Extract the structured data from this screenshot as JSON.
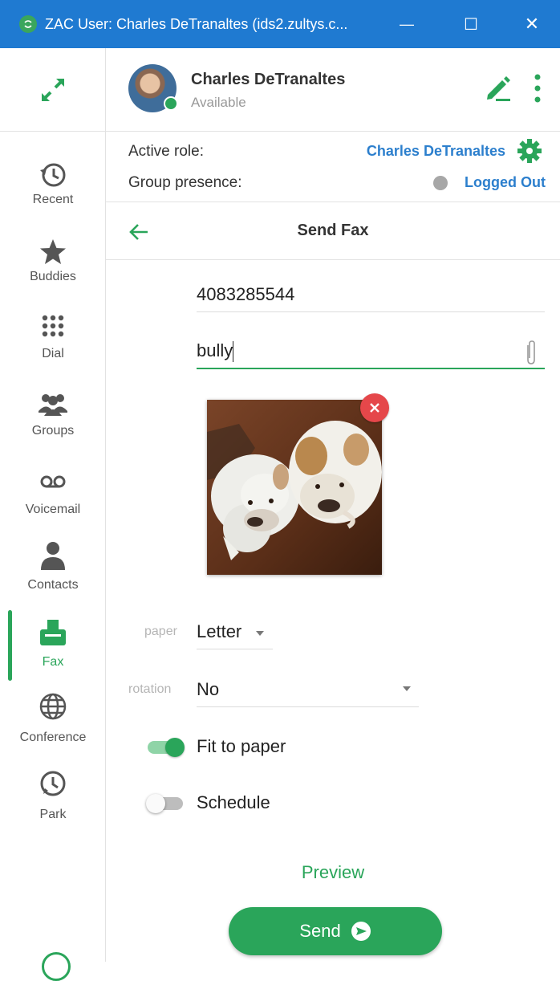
{
  "window": {
    "title": "ZAC User: Charles DeTranaltes (ids2.zultys.c...",
    "minimize_glyph": "—",
    "maximize_glyph": "☐",
    "close_glyph": "✕"
  },
  "sidebar": {
    "items": [
      {
        "label": "Recent",
        "icon": "history-icon"
      },
      {
        "label": "Buddies",
        "icon": "star-icon"
      },
      {
        "label": "Dial",
        "icon": "dialpad-icon"
      },
      {
        "label": "Groups",
        "icon": "group-icon"
      },
      {
        "label": "Voicemail",
        "icon": "voicemail-icon"
      },
      {
        "label": "Contacts",
        "icon": "person-icon"
      },
      {
        "label": "Fax",
        "icon": "fax-icon",
        "active": true
      },
      {
        "label": "Conference",
        "icon": "globe-icon"
      },
      {
        "label": "Park",
        "icon": "park-icon"
      }
    ]
  },
  "user": {
    "name": "Charles DeTranaltes",
    "status": "Available"
  },
  "roles": {
    "active_role_label": "Active role:",
    "active_role_value": "Charles DeTranaltes",
    "group_presence_label": "Group presence:",
    "group_presence_value": "Logged Out"
  },
  "page": {
    "title": "Send Fax"
  },
  "form": {
    "fax_number": "4083285544",
    "subject": "bully",
    "paper_label": "paper",
    "paper_value": "Letter",
    "rotation_label": "rotation",
    "rotation_value": "No",
    "fit_to_paper_label": "Fit to paper",
    "fit_to_paper_on": true,
    "schedule_label": "Schedule",
    "schedule_on": false,
    "preview_label": "Preview",
    "send_label": "Send"
  },
  "colors": {
    "accent_green": "#2aa55a",
    "titlebar_blue": "#1f7ad1",
    "link_blue": "#2c7fcd",
    "remove_red": "#e5474a"
  }
}
